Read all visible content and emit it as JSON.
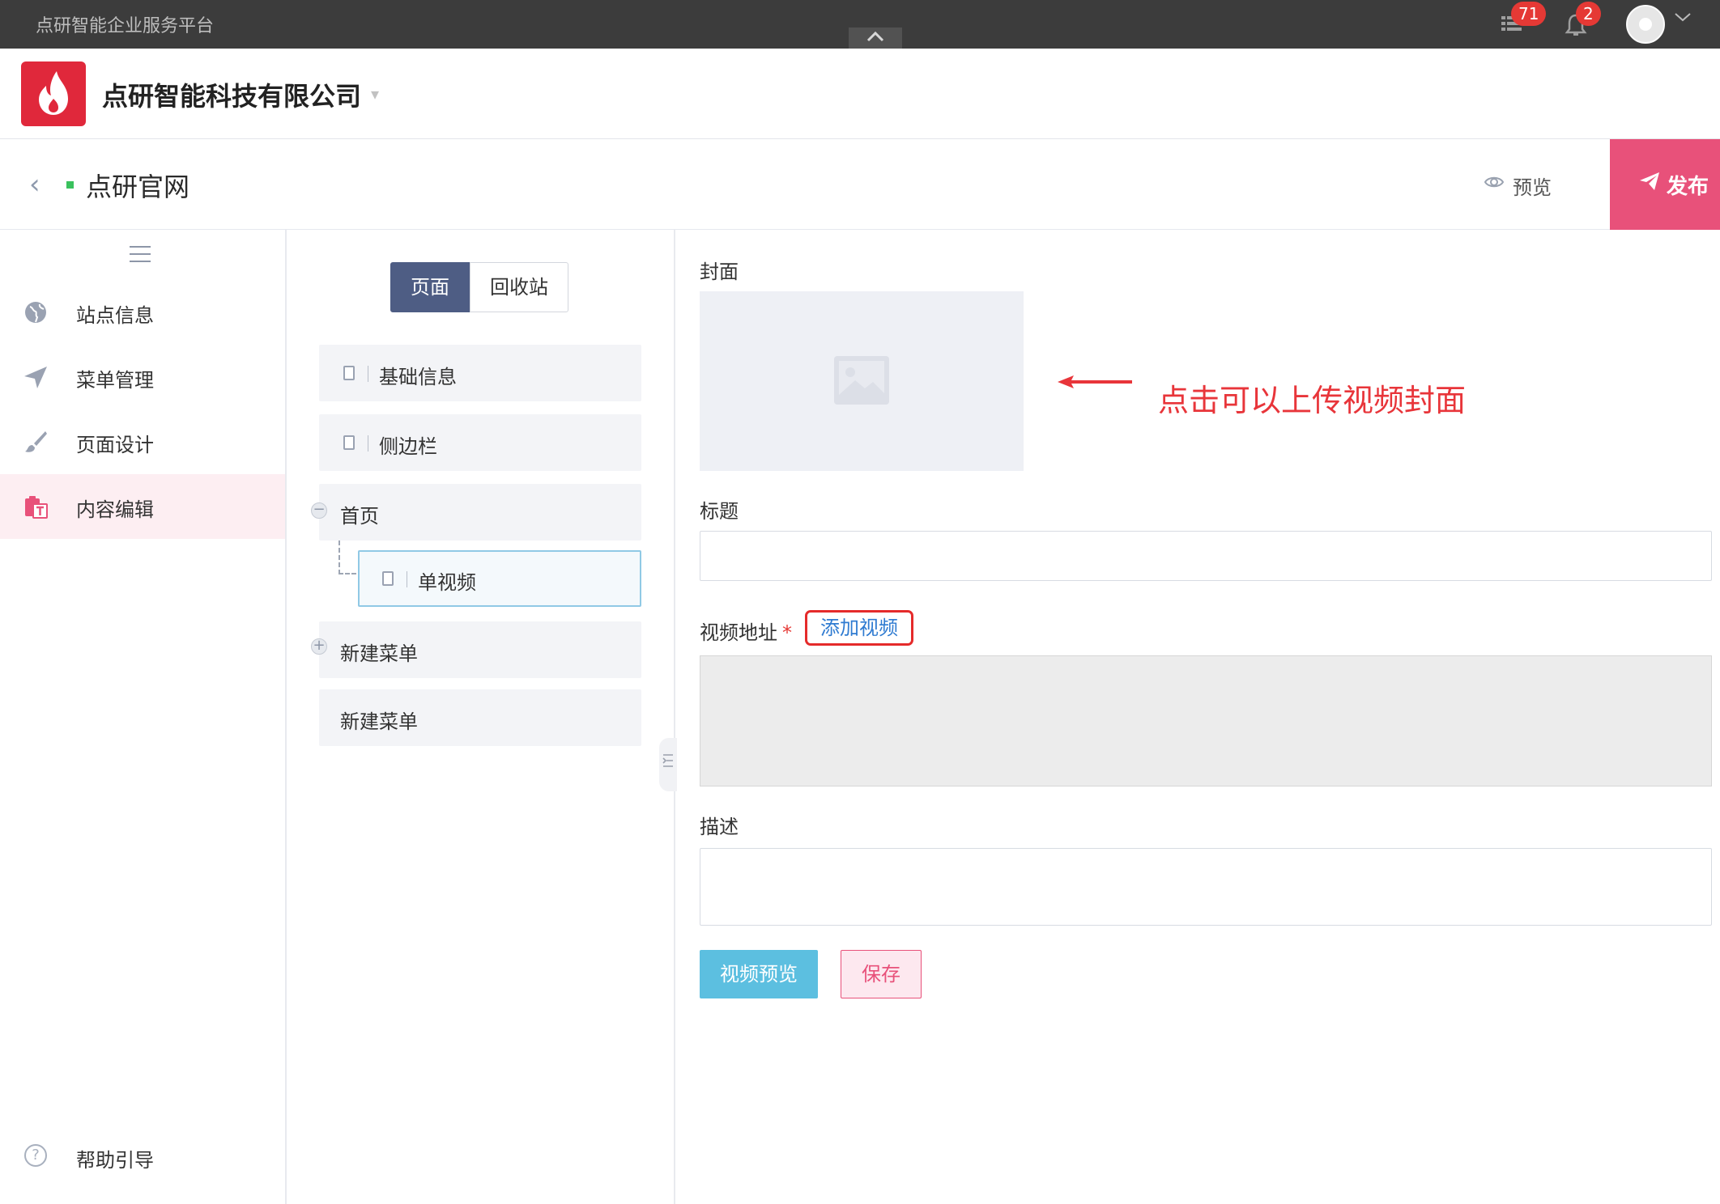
{
  "topbar": {
    "platform_title": "点研智能企业服务平台",
    "collapse_icon": "chevron-up-icon",
    "tasks_badge": "71",
    "notifications_badge": "2"
  },
  "company": {
    "name": "点研智能科技有限公司",
    "caret": "▾"
  },
  "site_header": {
    "back_icon": "‹",
    "site_name": "点研官网",
    "preview_label": "预览",
    "publish_label": "发布"
  },
  "left_nav": {
    "items": [
      {
        "label": "站点信息",
        "icon": "globe-icon"
      },
      {
        "label": "菜单管理",
        "icon": "send-icon"
      },
      {
        "label": "页面设计",
        "icon": "brush-icon"
      },
      {
        "label": "内容编辑",
        "icon": "content-edit-icon",
        "active": true
      }
    ],
    "help_label": "帮助引导",
    "help_icon": "question-icon"
  },
  "tree_panel": {
    "tabs": [
      {
        "label": "页面",
        "active": true
      },
      {
        "label": "回收站",
        "active": false
      }
    ],
    "nodes": [
      {
        "label": "基础信息"
      },
      {
        "label": "侧边栏"
      },
      {
        "label": "首页",
        "toggle": "−"
      },
      {
        "label": "单视频"
      },
      {
        "label": "新建菜单",
        "toggle": "+"
      },
      {
        "label": "新建菜单"
      }
    ]
  },
  "editor": {
    "cover_label": "封面",
    "annotation": "点击可以上传视频封面",
    "title_label": "标题",
    "title_value": "",
    "video_url_label": "视频地址",
    "required_mark": "*",
    "add_video_label": "添加视频",
    "description_label": "描述",
    "description_value": "",
    "video_preview_button": "视频预览",
    "save_button": "保存"
  },
  "colors": {
    "topbar": "#3c3c3c",
    "brand_red": "#e0283b",
    "publish_pink": "#e8517a",
    "tab_active": "#4e5d84",
    "preview_button": "#5cbfe0",
    "annotation_red": "#e8353a"
  }
}
